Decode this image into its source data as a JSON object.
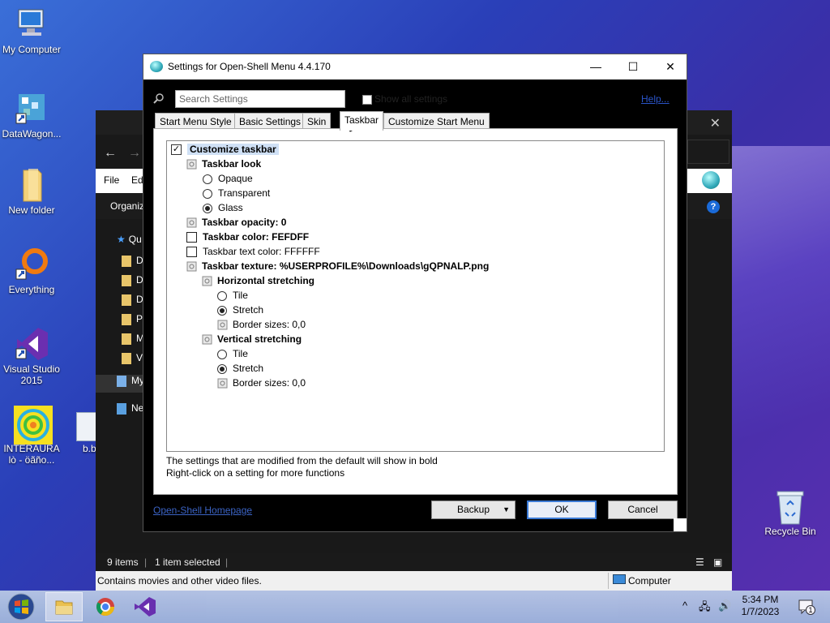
{
  "desktop": {
    "icons": [
      {
        "label": "My Computer"
      },
      {
        "label": "DataWagon..."
      },
      {
        "label": "New folder"
      },
      {
        "label": "Everything"
      },
      {
        "label": "Visual Studio 2015"
      },
      {
        "label": "INTERAURA lò - öãño..."
      },
      {
        "label": "b.b"
      },
      {
        "label": "Recycle Bin"
      }
    ]
  },
  "explorer": {
    "ribbon": {
      "file": "File",
      "edit": "Ed"
    },
    "organize": "Organiz",
    "sidebar": [
      "Qu",
      "D",
      "D",
      "D",
      "P",
      "M",
      "V",
      "My",
      "Ne"
    ],
    "status": {
      "items": "9 items",
      "selected": "1 item selected"
    },
    "info": {
      "text": "Contains movies and other video files.",
      "location": "Computer"
    }
  },
  "dialog": {
    "title": "Settings for Open-Shell Menu 4.4.170",
    "search_placeholder": "Search Settings",
    "show_all": "Show all settings",
    "help": "Help...",
    "tabs": [
      "Start Menu Style",
      "Basic Settings",
      "Skin",
      "Taskbar",
      "Customize Start Menu"
    ],
    "active_tab": "Taskbar",
    "tree": {
      "customize": "Customize taskbar",
      "look": "Taskbar look",
      "opaque": "Opaque",
      "transparent": "Transparent",
      "glass": "Glass",
      "opacity": "Taskbar opacity: 0",
      "color": "Taskbar color: FEFDFF",
      "text_color": "Taskbar text color: FFFFFF",
      "texture": "Taskbar texture: %USERPROFILE%\\Downloads\\gQPNALP.png",
      "horizontal": "Horizontal stretching",
      "h_tile": "Tile",
      "h_stretch": "Stretch",
      "h_border": "Border sizes: 0,0",
      "vertical": "Vertical stretching",
      "v_tile": "Tile",
      "v_stretch": "Stretch",
      "v_border": "Border sizes: 0,0"
    },
    "footnote1": "The settings that are modified from the default will show in bold",
    "footnote2": "Right-click on a setting for more functions",
    "homepage": "Open-Shell Homepage",
    "backup": "Backup",
    "ok": "OK",
    "cancel": "Cancel"
  },
  "taskbar": {
    "time": "5:34 PM",
    "date": "1/7/2023",
    "notification_count": "1"
  }
}
